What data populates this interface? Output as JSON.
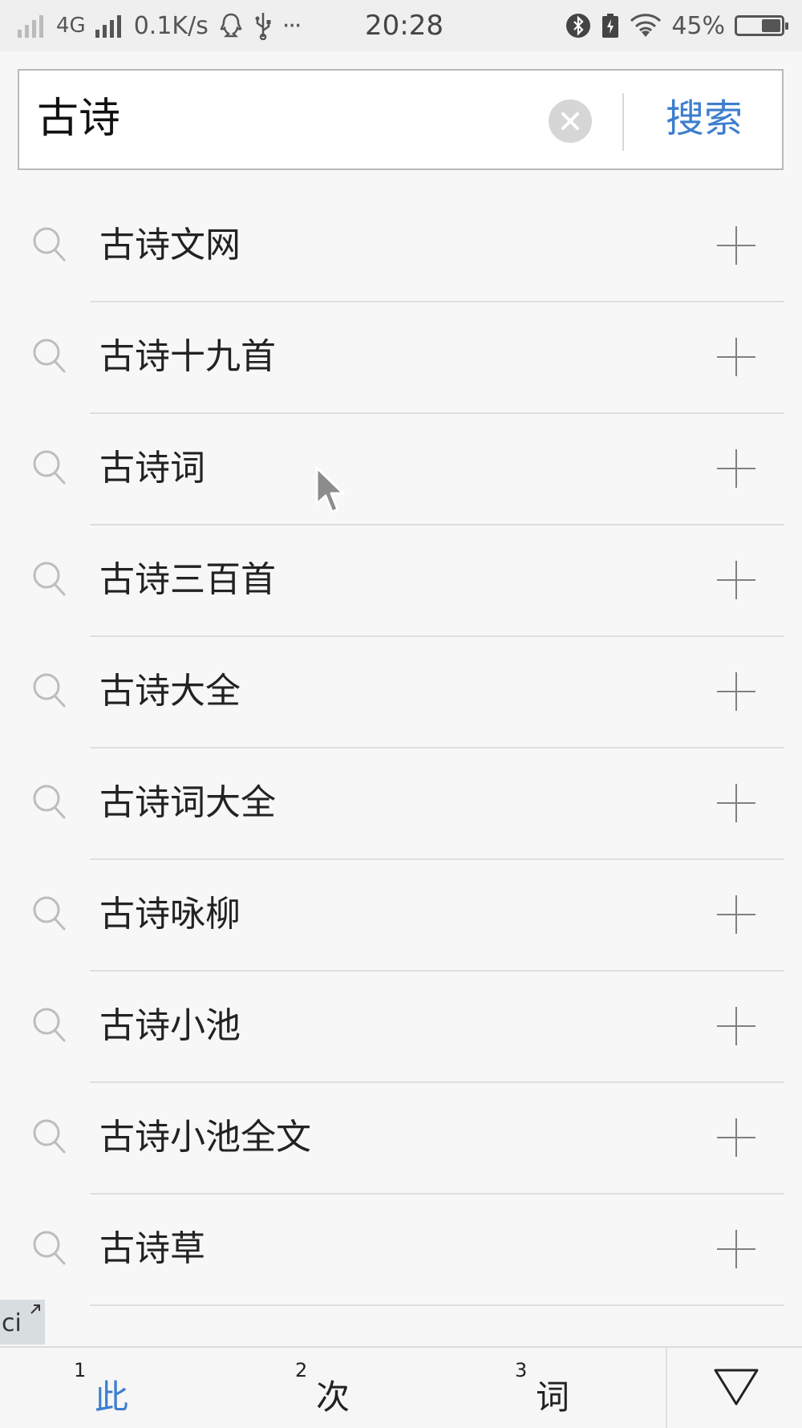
{
  "status_bar": {
    "network": "4G",
    "speed": "0.1K/s",
    "more": "···",
    "time": "20:28",
    "battery": "45%",
    "battery_level": 0.45
  },
  "search": {
    "query": "古诗",
    "button_label": "搜索"
  },
  "suggestions": [
    {
      "text": "古诗文网"
    },
    {
      "text": "古诗十九首"
    },
    {
      "text": "古诗词"
    },
    {
      "text": "古诗三百首"
    },
    {
      "text": "古诗大全"
    },
    {
      "text": "古诗词大全"
    },
    {
      "text": "古诗咏柳"
    },
    {
      "text": "古诗小池"
    },
    {
      "text": "古诗小池全文"
    },
    {
      "text": "古诗草"
    }
  ],
  "ime": {
    "mode_label": "ci",
    "candidates": [
      {
        "index": "1",
        "word": "此"
      },
      {
        "index": "2",
        "word": "次"
      },
      {
        "index": "3",
        "word": "词"
      }
    ],
    "accent_color": "#3d7ecf"
  }
}
